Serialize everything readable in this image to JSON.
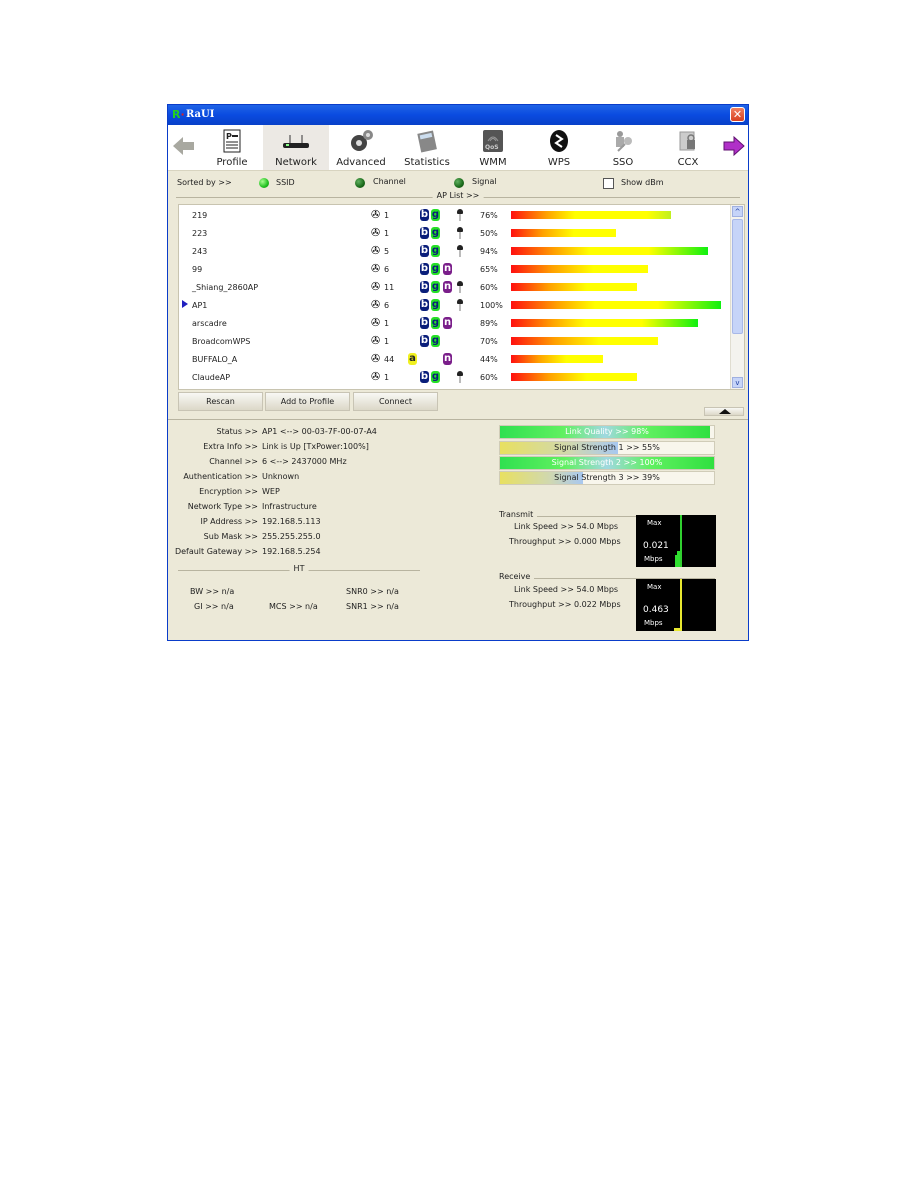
{
  "window": {
    "title": "RaUI",
    "close_label": "✕"
  },
  "toolbar": {
    "items": [
      {
        "label": "Profile",
        "icon": "profile-icon"
      },
      {
        "label": "Network",
        "icon": "network-icon",
        "active": true
      },
      {
        "label": "Advanced",
        "icon": "advanced-icon"
      },
      {
        "label": "Statistics",
        "icon": "statistics-icon"
      },
      {
        "label": "WMM",
        "icon": "wmm-qos-icon"
      },
      {
        "label": "WPS",
        "icon": "wps-icon"
      },
      {
        "label": "SSO",
        "icon": "sso-icon"
      },
      {
        "label": "CCX",
        "icon": "ccx-icon"
      }
    ]
  },
  "sort": {
    "label": "Sorted by >>",
    "options": [
      {
        "label": "SSID",
        "selected": true
      },
      {
        "label": "Channel",
        "selected": false
      },
      {
        "label": "Signal",
        "selected": false
      }
    ],
    "show_dbm_label": "Show dBm",
    "show_dbm_checked": false
  },
  "ap_list": {
    "title": "AP List >>",
    "rows": [
      {
        "ssid": "219",
        "channel": "1",
        "modes": [
          "b",
          "g"
        ],
        "secured": true,
        "signal": "76%",
        "signal_value": 76,
        "selected": false
      },
      {
        "ssid": "223",
        "channel": "1",
        "modes": [
          "b",
          "g"
        ],
        "secured": true,
        "signal": "50%",
        "signal_value": 50,
        "selected": false
      },
      {
        "ssid": "243",
        "channel": "5",
        "modes": [
          "b",
          "g"
        ],
        "secured": true,
        "signal": "94%",
        "signal_value": 94,
        "selected": false
      },
      {
        "ssid": "99",
        "channel": "6",
        "modes": [
          "b",
          "g",
          "n"
        ],
        "secured": false,
        "signal": "65%",
        "signal_value": 65,
        "selected": false
      },
      {
        "ssid": "_Shiang_2860AP",
        "channel": "11",
        "modes": [
          "b",
          "g",
          "n"
        ],
        "secured": true,
        "signal": "60%",
        "signal_value": 60,
        "selected": false
      },
      {
        "ssid": "AP1",
        "channel": "6",
        "modes": [
          "b",
          "g"
        ],
        "secured": true,
        "signal": "100%",
        "signal_value": 100,
        "selected": true
      },
      {
        "ssid": "arscadre",
        "channel": "1",
        "modes": [
          "b",
          "g",
          "n"
        ],
        "secured": false,
        "signal": "89%",
        "signal_value": 89,
        "selected": false
      },
      {
        "ssid": "BroadcomWPS",
        "channel": "1",
        "modes": [
          "b",
          "g"
        ],
        "secured": false,
        "signal": "70%",
        "signal_value": 70,
        "selected": false
      },
      {
        "ssid": "BUFFALO_A",
        "channel": "44",
        "modes": [
          "a",
          "n"
        ],
        "secured": false,
        "signal": "44%",
        "signal_value": 44,
        "selected": false
      },
      {
        "ssid": "ClaudeAP",
        "channel": "1",
        "modes": [
          "b",
          "g"
        ],
        "secured": true,
        "signal": "60%",
        "signal_value": 60,
        "selected": false
      }
    ]
  },
  "buttons": {
    "rescan": "Rescan",
    "add_to_profile": "Add to Profile",
    "connect": "Connect"
  },
  "info": [
    {
      "label": "Status >>",
      "value": "AP1 <--> 00-03-7F-00-07-A4"
    },
    {
      "label": "Extra Info >>",
      "value": "Link is Up [TxPower:100%]"
    },
    {
      "label": "Channel >>",
      "value": "6 <--> 2437000 MHz"
    },
    {
      "label": "Authentication >>",
      "value": "Unknown"
    },
    {
      "label": "Encryption >>",
      "value": "WEP"
    },
    {
      "label": "Network Type >>",
      "value": "Infrastructure"
    },
    {
      "label": "IP Address >>",
      "value": "192.168.5.113"
    },
    {
      "label": "Sub Mask >>",
      "value": "255.255.255.0"
    },
    {
      "label": "Default Gateway >>",
      "value": "192.168.5.254"
    }
  ],
  "ht": {
    "title": "HT",
    "bw": "BW >> n/a",
    "gi": "GI >> n/a",
    "mcs": "MCS >> n/a",
    "snr0": "SNR0 >> n/a",
    "snr1": "SNR1 >> n/a"
  },
  "quality": [
    {
      "label": "Link Quality >> 98%",
      "value": 98,
      "style": "green"
    },
    {
      "label": "Signal Strength 1 >> 55%",
      "value": 55,
      "style": "yellow"
    },
    {
      "label": "Signal Strength 2 >> 100%",
      "value": 100,
      "style": "green"
    },
    {
      "label": "Signal Strength 3 >> 39%",
      "value": 39,
      "style": "yellow"
    }
  ],
  "transmit": {
    "title": "Transmit",
    "link_speed": "Link Speed >> 54.0 Mbps",
    "throughput": "Throughput >> 0.000 Mbps",
    "graph_max": "Max",
    "graph_value": "0.021",
    "graph_unit": "Mbps",
    "graph_color": "#30d030"
  },
  "receive": {
    "title": "Receive",
    "link_speed": "Link Speed >> 54.0 Mbps",
    "throughput": "Throughput >> 0.022 Mbps",
    "graph_max": "Max",
    "graph_value": "0.463",
    "graph_unit": "Mbps",
    "graph_color": "#e8e830"
  }
}
